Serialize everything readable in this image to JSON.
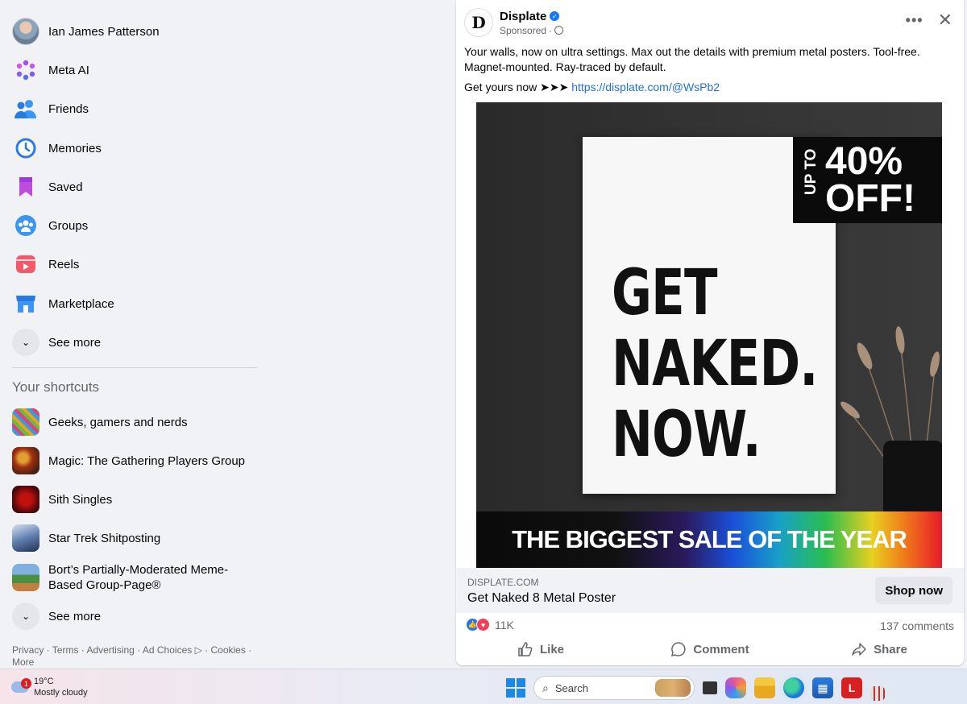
{
  "sidebar": {
    "profile_name": "Ian James Patterson",
    "items": [
      {
        "label": "Meta AI"
      },
      {
        "label": "Friends"
      },
      {
        "label": "Memories"
      },
      {
        "label": "Saved"
      },
      {
        "label": "Groups"
      },
      {
        "label": "Reels"
      },
      {
        "label": "Marketplace"
      }
    ],
    "see_more_label": "See more",
    "shortcuts_title": "Your shortcuts",
    "shortcuts": [
      {
        "label": "Geeks, gamers and nerds"
      },
      {
        "label": "Magic: The Gathering Players Group"
      },
      {
        "label": "Sith Singles"
      },
      {
        "label": "Star Trek Shitposting"
      },
      {
        "label": "Bort’s Partially-Moderated Meme-Based Group-Page®"
      }
    ],
    "shortcuts_see_more_label": "See more",
    "footer": {
      "privacy": "Privacy",
      "terms": "Terms",
      "advertising": "Advertising",
      "ad_choices": "Ad Choices",
      "cookies": "Cookies",
      "more": "More"
    }
  },
  "post": {
    "page_name": "Displate",
    "logo_letter": "D",
    "sponsored": "Sponsored",
    "body_line1": "Your walls, now on ultra settings. Max out the details with premium metal posters. Tool-free. Magnet-mounted. Ray-traced by default.",
    "body_line2_prefix": "Get yours now ➤➤➤ ",
    "link": "https://displate.com/@WsPb2",
    "ad_image": {
      "badge_upto": "UP TO",
      "badge_percent": "40%",
      "badge_off": "OFF!",
      "poster_line1": "GET",
      "poster_line2": "NAKED.",
      "poster_line3": "NOW.",
      "banner": "THE BIGGEST SALE OF THE YEAR"
    },
    "cta": {
      "domain": "DISPLATE.COM",
      "title": "Get Naked 8 Metal Poster",
      "button": "Shop now"
    },
    "reaction_count": "11K",
    "comments_count": "137 comments",
    "actions": {
      "like": "Like",
      "comment": "Comment",
      "share": "Share"
    }
  },
  "taskbar": {
    "weather_badge": "1",
    "temperature": "19°C",
    "condition": "Mostly cloudy",
    "search_placeholder": "Search"
  },
  "colors": {
    "link": "#216fdb",
    "like_blue": "#1877f2",
    "love_red": "#f33e58",
    "background": "#f0f2f5"
  }
}
